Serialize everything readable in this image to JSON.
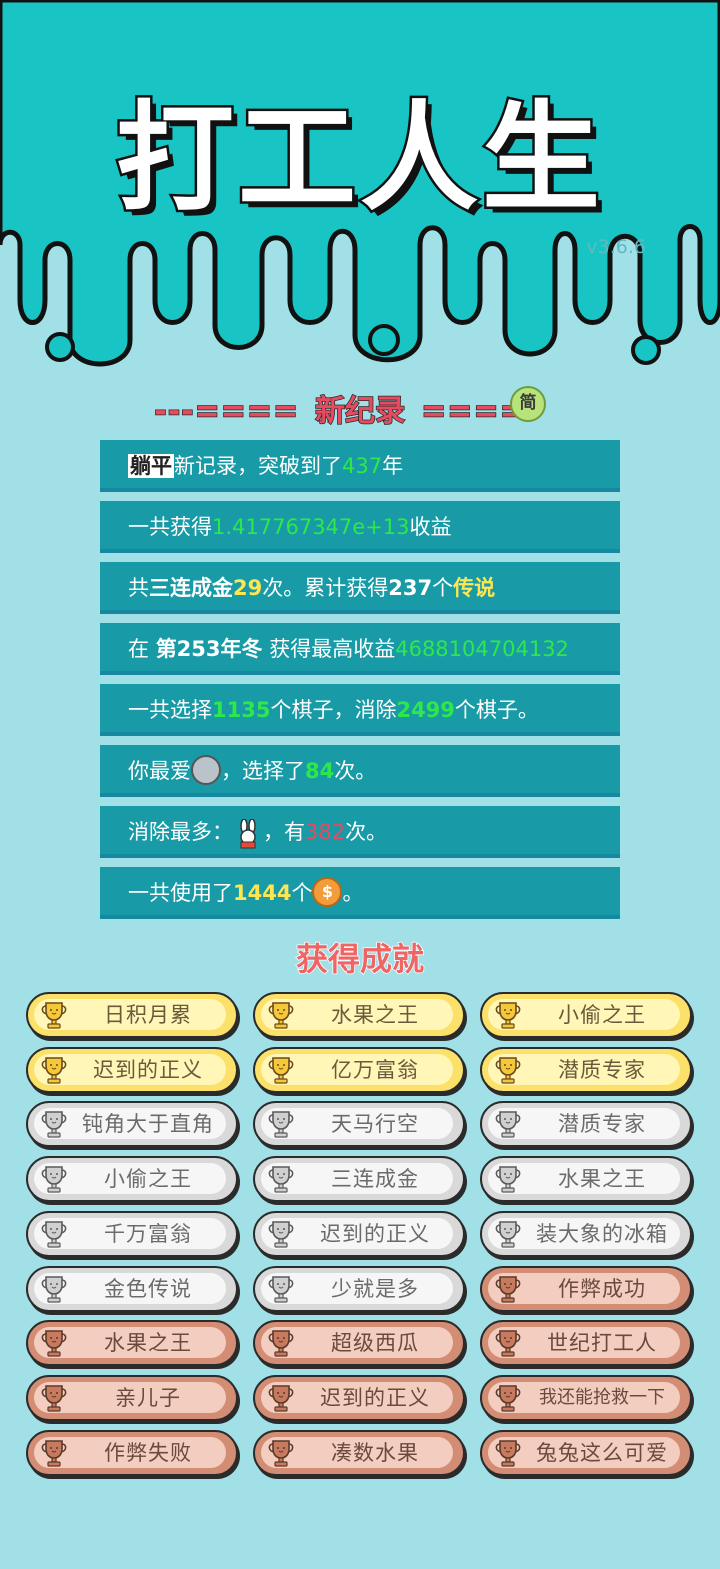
{
  "app": {
    "title": "打工人生",
    "version": "v3.6.6"
  },
  "record": {
    "dashes_left": "---====",
    "title": "新纪录",
    "dashes_right": "====",
    "simplified_label": "简"
  },
  "stats": {
    "r1": {
      "a": "躺平",
      "b": "新记录，突破到了",
      "c": "437",
      "d": "年"
    },
    "r2": {
      "a": "一共获得",
      "b": "1.417767347e+13",
      "c": "收益"
    },
    "r3": {
      "a": "共",
      "b": "三连成金",
      "c": "29",
      "d": "次。累计获得",
      "e": "237",
      "f": "个",
      "g": "传说"
    },
    "r4": {
      "a": "在 ",
      "b": "第253年冬",
      "c": " 获得最高收益",
      "d": "4688104704132"
    },
    "r5": {
      "a": "一共选择",
      "b": "1135",
      "c": "个棋子，消除",
      "d": "2499",
      "e": "个棋子。"
    },
    "r6": {
      "a": "你最爱",
      "b": "，选择了",
      "c": "84",
      "d": "次。"
    },
    "r7": {
      "a": "消除最多：",
      "b": "，有",
      "c": "382",
      "d": "次。"
    },
    "r8": {
      "a": "一共使用了",
      "b": "1444",
      "c": "个",
      "d": "。"
    }
  },
  "achievements_title": "获得成就",
  "achievements": [
    {
      "label": "日积月累",
      "tier": "gold"
    },
    {
      "label": "水果之王",
      "tier": "gold"
    },
    {
      "label": "小偷之王",
      "tier": "gold"
    },
    {
      "label": "迟到的正义",
      "tier": "gold"
    },
    {
      "label": "亿万富翁",
      "tier": "gold"
    },
    {
      "label": "潜质专家",
      "tier": "gold"
    },
    {
      "label": "钝角大于直角",
      "tier": "silver"
    },
    {
      "label": "天马行空",
      "tier": "silver"
    },
    {
      "label": "潜质专家",
      "tier": "silver"
    },
    {
      "label": "小偷之王",
      "tier": "silver"
    },
    {
      "label": "三连成金",
      "tier": "silver"
    },
    {
      "label": "水果之王",
      "tier": "silver"
    },
    {
      "label": "千万富翁",
      "tier": "silver"
    },
    {
      "label": "迟到的正义",
      "tier": "silver"
    },
    {
      "label": "装大象的冰箱",
      "tier": "silver"
    },
    {
      "label": "金色传说",
      "tier": "silver"
    },
    {
      "label": "少就是多",
      "tier": "silver"
    },
    {
      "label": "作弊成功",
      "tier": "bronze"
    },
    {
      "label": "水果之王",
      "tier": "bronze"
    },
    {
      "label": "超级西瓜",
      "tier": "bronze"
    },
    {
      "label": "世纪打工人",
      "tier": "bronze"
    },
    {
      "label": "亲儿子",
      "tier": "bronze"
    },
    {
      "label": "迟到的正义",
      "tier": "bronze"
    },
    {
      "label": "我还能抢救一下",
      "tier": "bronze"
    },
    {
      "label": "作弊失败",
      "tier": "bronze"
    },
    {
      "label": "凑数水果",
      "tier": "bronze"
    },
    {
      "label": "兔兔这么可爱",
      "tier": "bronze"
    }
  ],
  "colors": {
    "header_bg": "#18c5c4",
    "page_bg": "#a1e0e6",
    "stat_bg": "#189ba6",
    "highlight_green": "#2ee84a",
    "highlight_yellow": "#ffe651",
    "highlight_red": "#e84a5f",
    "gold": "#fbe16a",
    "silver": "#d9d9d9",
    "bronze": "#d38d74"
  }
}
